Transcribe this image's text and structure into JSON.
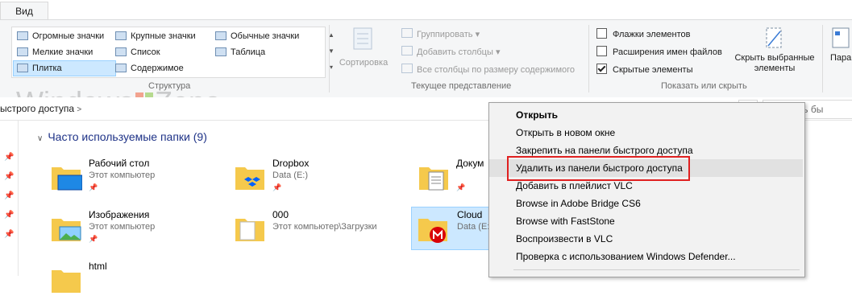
{
  "ribbon": {
    "tab_label": "Вид",
    "layout": {
      "items": [
        {
          "label": "Огромные значки",
          "selected": false
        },
        {
          "label": "Крупные значки",
          "selected": false
        },
        {
          "label": "Обычные значки",
          "selected": false
        },
        {
          "label": "Мелкие значки",
          "selected": false
        },
        {
          "label": "Список",
          "selected": false
        },
        {
          "label": "Таблица",
          "selected": false
        },
        {
          "label": "Плитка",
          "selected": true
        },
        {
          "label": "Содержимое",
          "selected": false
        }
      ],
      "group_label": "Структура"
    },
    "current_view": {
      "sort_label": "Сортировка",
      "group_label_btn": "Группировать",
      "add_columns": "Добавить столбцы",
      "fit_columns": "Все столбцы по размеру содержимого",
      "group_label": "Текущее представление"
    },
    "show_hide": {
      "item_checkboxes": {
        "label": "Флажки элементов",
        "checked": false
      },
      "file_extensions": {
        "label": "Расширения имен файлов",
        "checked": false
      },
      "hidden_items": {
        "label": "Скрытые элементы",
        "checked": true
      },
      "hide_selected_line1": "Скрыть выбранные",
      "hide_selected_line2": "элементы",
      "group_label": "Показать или скрыть"
    },
    "params_partial": "Пара"
  },
  "address": {
    "path": "ыстрого доступа",
    "search_placeholder": "Панель бы"
  },
  "watermark": {
    "part1": "Windows",
    "part2": "Zona"
  },
  "content": {
    "section_title": "Часто используемые папки (9)",
    "tiles": [
      {
        "name": "Рабочий стол",
        "sub": "Этот компьютер",
        "pinned": true
      },
      {
        "name": "Dropbox",
        "sub": "Data (E:)",
        "pinned": true
      },
      {
        "name": "Докум",
        "sub": "",
        "pinned": true
      },
      {
        "name": "Изображения",
        "sub": "Этот компьютер",
        "pinned": true
      },
      {
        "name": "000",
        "sub": "Этот компьютер\\Загрузки",
        "pinned": false
      },
      {
        "name": "Cloud",
        "sub": "Data (E:",
        "pinned": false
      },
      {
        "name": "html",
        "sub": "",
        "pinned": false
      }
    ]
  },
  "context_menu": {
    "items": [
      {
        "label": "Открыть",
        "bold": true,
        "highlighted": false
      },
      {
        "label": "Открыть в новом окне",
        "bold": false,
        "highlighted": false
      },
      {
        "label": "Закрепить на панели быстрого доступа",
        "bold": false,
        "highlighted": false
      },
      {
        "label": "Удалить из панели быстрого доступа",
        "bold": false,
        "highlighted": true
      },
      {
        "label": "Добавить в плейлист VLC",
        "bold": false,
        "highlighted": false
      },
      {
        "label": "Browse in Adobe Bridge CS6",
        "bold": false,
        "highlighted": false
      },
      {
        "label": "Browse with FastStone",
        "bold": false,
        "highlighted": false
      },
      {
        "label": "Воспроизвести в VLC",
        "bold": false,
        "highlighted": false
      },
      {
        "label": "Проверка с использованием Windows Defender...",
        "bold": false,
        "highlighted": false
      }
    ]
  },
  "colors": {
    "accent_blue": "#0078d7",
    "selection": "#cce8ff",
    "highlight_box": "#e02020",
    "folder": "#f5c94c"
  }
}
